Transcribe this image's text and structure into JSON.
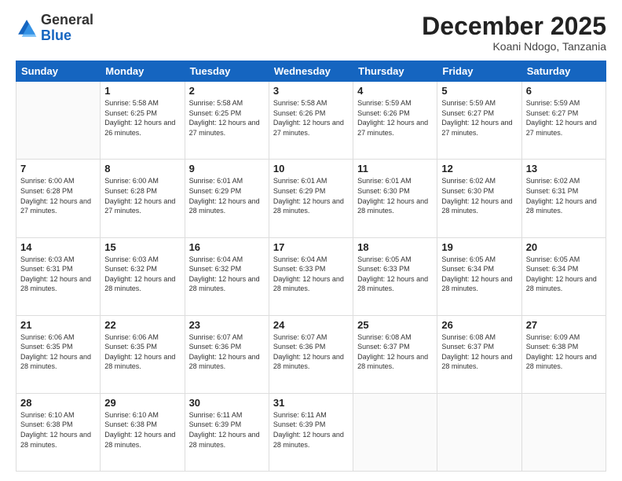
{
  "logo": {
    "general": "General",
    "blue": "Blue"
  },
  "header": {
    "month": "December 2025",
    "location": "Koani Ndogo, Tanzania"
  },
  "days_of_week": [
    "Sunday",
    "Monday",
    "Tuesday",
    "Wednesday",
    "Thursday",
    "Friday",
    "Saturday"
  ],
  "weeks": [
    [
      {
        "day": "",
        "sunrise": "",
        "sunset": "",
        "daylight": ""
      },
      {
        "day": "1",
        "sunrise": "Sunrise: 5:58 AM",
        "sunset": "Sunset: 6:25 PM",
        "daylight": "Daylight: 12 hours and 26 minutes."
      },
      {
        "day": "2",
        "sunrise": "Sunrise: 5:58 AM",
        "sunset": "Sunset: 6:25 PM",
        "daylight": "Daylight: 12 hours and 27 minutes."
      },
      {
        "day": "3",
        "sunrise": "Sunrise: 5:58 AM",
        "sunset": "Sunset: 6:26 PM",
        "daylight": "Daylight: 12 hours and 27 minutes."
      },
      {
        "day": "4",
        "sunrise": "Sunrise: 5:59 AM",
        "sunset": "Sunset: 6:26 PM",
        "daylight": "Daylight: 12 hours and 27 minutes."
      },
      {
        "day": "5",
        "sunrise": "Sunrise: 5:59 AM",
        "sunset": "Sunset: 6:27 PM",
        "daylight": "Daylight: 12 hours and 27 minutes."
      },
      {
        "day": "6",
        "sunrise": "Sunrise: 5:59 AM",
        "sunset": "Sunset: 6:27 PM",
        "daylight": "Daylight: 12 hours and 27 minutes."
      }
    ],
    [
      {
        "day": "7",
        "sunrise": "Sunrise: 6:00 AM",
        "sunset": "Sunset: 6:28 PM",
        "daylight": "Daylight: 12 hours and 27 minutes."
      },
      {
        "day": "8",
        "sunrise": "Sunrise: 6:00 AM",
        "sunset": "Sunset: 6:28 PM",
        "daylight": "Daylight: 12 hours and 27 minutes."
      },
      {
        "day": "9",
        "sunrise": "Sunrise: 6:01 AM",
        "sunset": "Sunset: 6:29 PM",
        "daylight": "Daylight: 12 hours and 28 minutes."
      },
      {
        "day": "10",
        "sunrise": "Sunrise: 6:01 AM",
        "sunset": "Sunset: 6:29 PM",
        "daylight": "Daylight: 12 hours and 28 minutes."
      },
      {
        "day": "11",
        "sunrise": "Sunrise: 6:01 AM",
        "sunset": "Sunset: 6:30 PM",
        "daylight": "Daylight: 12 hours and 28 minutes."
      },
      {
        "day": "12",
        "sunrise": "Sunrise: 6:02 AM",
        "sunset": "Sunset: 6:30 PM",
        "daylight": "Daylight: 12 hours and 28 minutes."
      },
      {
        "day": "13",
        "sunrise": "Sunrise: 6:02 AM",
        "sunset": "Sunset: 6:31 PM",
        "daylight": "Daylight: 12 hours and 28 minutes."
      }
    ],
    [
      {
        "day": "14",
        "sunrise": "Sunrise: 6:03 AM",
        "sunset": "Sunset: 6:31 PM",
        "daylight": "Daylight: 12 hours and 28 minutes."
      },
      {
        "day": "15",
        "sunrise": "Sunrise: 6:03 AM",
        "sunset": "Sunset: 6:32 PM",
        "daylight": "Daylight: 12 hours and 28 minutes."
      },
      {
        "day": "16",
        "sunrise": "Sunrise: 6:04 AM",
        "sunset": "Sunset: 6:32 PM",
        "daylight": "Daylight: 12 hours and 28 minutes."
      },
      {
        "day": "17",
        "sunrise": "Sunrise: 6:04 AM",
        "sunset": "Sunset: 6:33 PM",
        "daylight": "Daylight: 12 hours and 28 minutes."
      },
      {
        "day": "18",
        "sunrise": "Sunrise: 6:05 AM",
        "sunset": "Sunset: 6:33 PM",
        "daylight": "Daylight: 12 hours and 28 minutes."
      },
      {
        "day": "19",
        "sunrise": "Sunrise: 6:05 AM",
        "sunset": "Sunset: 6:34 PM",
        "daylight": "Daylight: 12 hours and 28 minutes."
      },
      {
        "day": "20",
        "sunrise": "Sunrise: 6:05 AM",
        "sunset": "Sunset: 6:34 PM",
        "daylight": "Daylight: 12 hours and 28 minutes."
      }
    ],
    [
      {
        "day": "21",
        "sunrise": "Sunrise: 6:06 AM",
        "sunset": "Sunset: 6:35 PM",
        "daylight": "Daylight: 12 hours and 28 minutes."
      },
      {
        "day": "22",
        "sunrise": "Sunrise: 6:06 AM",
        "sunset": "Sunset: 6:35 PM",
        "daylight": "Daylight: 12 hours and 28 minutes."
      },
      {
        "day": "23",
        "sunrise": "Sunrise: 6:07 AM",
        "sunset": "Sunset: 6:36 PM",
        "daylight": "Daylight: 12 hours and 28 minutes."
      },
      {
        "day": "24",
        "sunrise": "Sunrise: 6:07 AM",
        "sunset": "Sunset: 6:36 PM",
        "daylight": "Daylight: 12 hours and 28 minutes."
      },
      {
        "day": "25",
        "sunrise": "Sunrise: 6:08 AM",
        "sunset": "Sunset: 6:37 PM",
        "daylight": "Daylight: 12 hours and 28 minutes."
      },
      {
        "day": "26",
        "sunrise": "Sunrise: 6:08 AM",
        "sunset": "Sunset: 6:37 PM",
        "daylight": "Daylight: 12 hours and 28 minutes."
      },
      {
        "day": "27",
        "sunrise": "Sunrise: 6:09 AM",
        "sunset": "Sunset: 6:38 PM",
        "daylight": "Daylight: 12 hours and 28 minutes."
      }
    ],
    [
      {
        "day": "28",
        "sunrise": "Sunrise: 6:10 AM",
        "sunset": "Sunset: 6:38 PM",
        "daylight": "Daylight: 12 hours and 28 minutes."
      },
      {
        "day": "29",
        "sunrise": "Sunrise: 6:10 AM",
        "sunset": "Sunset: 6:38 PM",
        "daylight": "Daylight: 12 hours and 28 minutes."
      },
      {
        "day": "30",
        "sunrise": "Sunrise: 6:11 AM",
        "sunset": "Sunset: 6:39 PM",
        "daylight": "Daylight: 12 hours and 28 minutes."
      },
      {
        "day": "31",
        "sunrise": "Sunrise: 6:11 AM",
        "sunset": "Sunset: 6:39 PM",
        "daylight": "Daylight: 12 hours and 28 minutes."
      },
      {
        "day": "",
        "sunrise": "",
        "sunset": "",
        "daylight": ""
      },
      {
        "day": "",
        "sunrise": "",
        "sunset": "",
        "daylight": ""
      },
      {
        "day": "",
        "sunrise": "",
        "sunset": "",
        "daylight": ""
      }
    ]
  ]
}
